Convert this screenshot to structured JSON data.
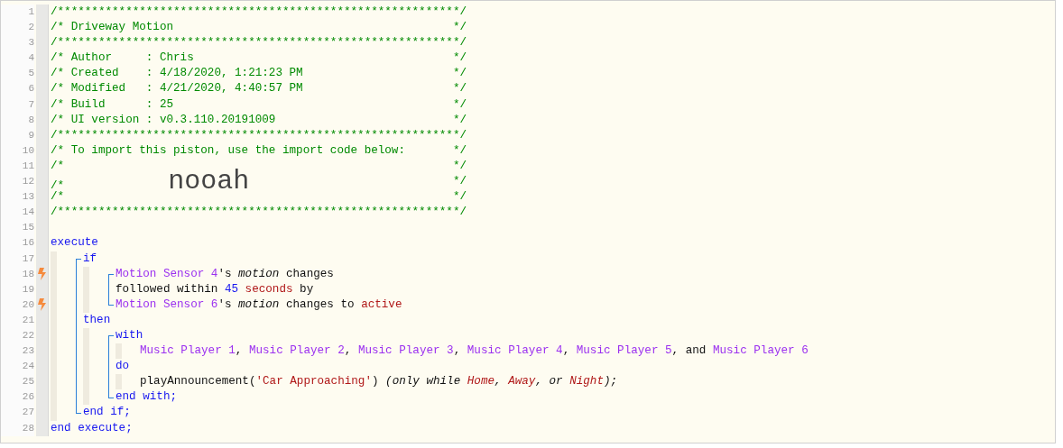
{
  "lines": [
    {
      "number": "1",
      "trigger": false,
      "tokens": [
        {
          "kind": "comment",
          "text": "/***********************************************************/"
        }
      ]
    },
    {
      "number": "2",
      "trigger": false,
      "tokens": [
        {
          "kind": "comment",
          "text": "/* Driveway Motion"
        }
      ],
      "close": "*/"
    },
    {
      "number": "3",
      "trigger": false,
      "tokens": [
        {
          "kind": "comment",
          "text": "/***********************************************************/"
        }
      ]
    },
    {
      "number": "4",
      "trigger": false,
      "tokens": [
        {
          "kind": "comment",
          "text": "/* Author     : Chris"
        }
      ],
      "close": "*/"
    },
    {
      "number": "5",
      "trigger": false,
      "tokens": [
        {
          "kind": "comment",
          "text": "/* Created    : 4/18/2020, 1:21:23 PM"
        }
      ],
      "close": "*/"
    },
    {
      "number": "6",
      "trigger": false,
      "tokens": [
        {
          "kind": "comment",
          "text": "/* Modified   : 4/21/2020, 4:40:57 PM"
        }
      ],
      "close": "*/"
    },
    {
      "number": "7",
      "trigger": false,
      "tokens": [
        {
          "kind": "comment",
          "text": "/* Build      : 25"
        }
      ],
      "close": "*/"
    },
    {
      "number": "8",
      "trigger": false,
      "tokens": [
        {
          "kind": "comment",
          "text": "/* UI version : v0.3.110.20191009"
        }
      ],
      "close": "*/"
    },
    {
      "number": "9",
      "trigger": false,
      "tokens": [
        {
          "kind": "comment",
          "text": "/***********************************************************/"
        }
      ]
    },
    {
      "number": "10",
      "trigger": false,
      "tokens": [
        {
          "kind": "comment",
          "text": "/* To import this piston, use the import code below:"
        }
      ],
      "close": "*/"
    },
    {
      "number": "11",
      "trigger": false,
      "tokens": [
        {
          "kind": "comment",
          "text": "/*"
        }
      ],
      "close": "*/"
    },
    {
      "number": "12",
      "trigger": false,
      "tokens": [
        {
          "kind": "comment",
          "text": "/*"
        },
        {
          "kind": "import_code",
          "text": "nooah"
        }
      ],
      "close": "*/"
    },
    {
      "number": "13",
      "trigger": false,
      "tokens": [
        {
          "kind": "comment",
          "text": "/*"
        }
      ],
      "close": "*/"
    },
    {
      "number": "14",
      "trigger": false,
      "tokens": [
        {
          "kind": "comment",
          "text": "/***********************************************************/"
        }
      ]
    },
    {
      "number": "15",
      "trigger": false
    },
    {
      "number": "16",
      "trigger": false,
      "tokens": [
        {
          "kind": "keyword",
          "text": "execute"
        }
      ],
      "children": [
        {
          "number": "17",
          "trigger": false,
          "tokens": [
            {
              "kind": "keyword",
              "text": "if"
            }
          ],
          "children": [
            {
              "number": "18",
              "trigger": true,
              "tokens": [
                {
                  "kind": "device",
                  "text": "Motion Sensor 4"
                },
                {
                  "kind": "plain",
                  "text": "'s "
                },
                {
                  "kind": "attribute",
                  "text": "motion"
                },
                {
                  "kind": "plain",
                  "text": " changes"
                }
              ]
            },
            {
              "number": "19",
              "trigger": false,
              "tokens": [
                {
                  "kind": "plain",
                  "text": "followed within "
                },
                {
                  "kind": "number",
                  "text": "45"
                },
                {
                  "kind": "value",
                  "text": " seconds"
                },
                {
                  "kind": "plain",
                  "text": " by"
                }
              ]
            },
            {
              "number": "20",
              "trigger": true,
              "tokens": [
                {
                  "kind": "device",
                  "text": "Motion Sensor 6"
                },
                {
                  "kind": "plain",
                  "text": "'s "
                },
                {
                  "kind": "attribute",
                  "text": "motion"
                },
                {
                  "kind": "plain",
                  "text": " changes to "
                },
                {
                  "kind": "value",
                  "text": "active"
                }
              ]
            }
          ]
        },
        {
          "number": "21",
          "trigger": false,
          "tokens": [
            {
              "kind": "keyword",
              "text": "then"
            }
          ],
          "children": [
            {
              "number": "22",
              "trigger": false,
              "tokens": [
                {
                  "kind": "keyword",
                  "text": "with"
                }
              ],
              "children": [
                {
                  "number": "23",
                  "trigger": false,
                  "tokens": [
                    {
                      "kind": "device",
                      "text": "Music Player 1"
                    },
                    {
                      "kind": "plain",
                      "text": ", "
                    },
                    {
                      "kind": "device",
                      "text": "Music Player 2"
                    },
                    {
                      "kind": "plain",
                      "text": ", "
                    },
                    {
                      "kind": "device",
                      "text": "Music Player 3"
                    },
                    {
                      "kind": "plain",
                      "text": ", "
                    },
                    {
                      "kind": "device",
                      "text": "Music Player 4"
                    },
                    {
                      "kind": "plain",
                      "text": ", "
                    },
                    {
                      "kind": "device",
                      "text": "Music Player 5"
                    },
                    {
                      "kind": "plain",
                      "text": ", and "
                    },
                    {
                      "kind": "device",
                      "text": "Music Player 6"
                    }
                  ]
                }
              ]
            },
            {
              "number": "24",
              "trigger": false,
              "tokens": [
                {
                  "kind": "keyword",
                  "text": "do"
                }
              ],
              "children": [
                {
                  "number": "25",
                  "trigger": false,
                  "tokens": [
                    {
                      "kind": "plain",
                      "text": "playAnnouncement("
                    },
                    {
                      "kind": "value",
                      "text": "'Car Approaching'"
                    },
                    {
                      "kind": "plain",
                      "text": ") "
                    },
                    {
                      "kind": "note",
                      "text": "(only while "
                    },
                    {
                      "kind": "mode",
                      "text": "Home"
                    },
                    {
                      "kind": "note",
                      "text": ", "
                    },
                    {
                      "kind": "mode",
                      "text": "Away"
                    },
                    {
                      "kind": "note",
                      "text": ", or "
                    },
                    {
                      "kind": "mode",
                      "text": "Night"
                    },
                    {
                      "kind": "note",
                      "text": ");"
                    }
                  ]
                }
              ]
            },
            {
              "number": "26",
              "trigger": false,
              "tokens": [
                {
                  "kind": "keyword",
                  "text": "end with;"
                }
              ]
            }
          ]
        },
        {
          "number": "27",
          "trigger": false,
          "tokens": [
            {
              "kind": "keyword",
              "text": "end if;"
            }
          ]
        }
      ]
    },
    {
      "number": "28",
      "trigger": false,
      "tokens": [
        {
          "kind": "keyword",
          "text": "end execute;"
        }
      ]
    }
  ]
}
